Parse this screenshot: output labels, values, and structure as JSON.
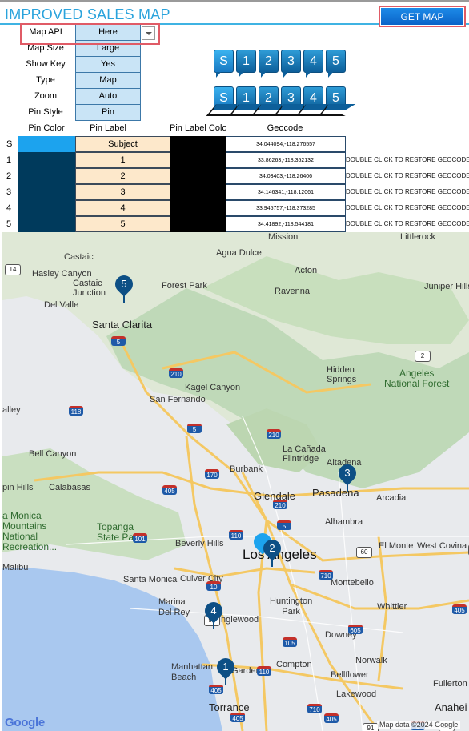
{
  "title": "IMPROVED SALES MAP",
  "get_map_label": "GET MAP",
  "settings": [
    {
      "label": "Map API",
      "value": "Here"
    },
    {
      "label": "Map Size",
      "value": "Large"
    },
    {
      "label": "Show Key",
      "value": "Yes"
    },
    {
      "label": "Type",
      "value": "Map"
    },
    {
      "label": "Zoom",
      "value": "Auto"
    },
    {
      "label": "Pin Style",
      "value": "Pin"
    }
  ],
  "pin_preview_labels": [
    "S",
    "1",
    "2",
    "3",
    "4",
    "5"
  ],
  "table": {
    "headers": [
      "Pin Color",
      "Pin Label",
      "Pin Label Colo",
      "Geocode"
    ],
    "rows": [
      {
        "id": "S",
        "label": "Subject",
        "geocode": "34.044094,-118.276557",
        "note": ""
      },
      {
        "id": "1",
        "label": "1",
        "geocode": "33.86263,-118.352132",
        "note": "DOUBLE CLICK TO RESTORE GEOCODE"
      },
      {
        "id": "2",
        "label": "2",
        "geocode": "34.03403,-118.26406",
        "note": "DOUBLE CLICK TO RESTORE GEOCODE"
      },
      {
        "id": "3",
        "label": "3",
        "geocode": "34.146341,-118.12061",
        "note": "DOUBLE CLICK TO RESTORE GEOCODE"
      },
      {
        "id": "4",
        "label": "4",
        "geocode": "33.945757,-118.373285",
        "note": "DOUBLE CLICK TO RESTORE GEOCODE"
      },
      {
        "id": "5",
        "label": "5",
        "geocode": "34.41892,-118.544181",
        "note": "DOUBLE CLICK TO RESTORE GEOCODE"
      }
    ]
  },
  "map": {
    "places": {
      "mission": "Mission",
      "littlerock": "Littlerock",
      "castaic": "Castaic",
      "agua_dulce": "Agua Dulce",
      "hasley": "Hasley Canyon",
      "acton": "Acton",
      "castaic_junction": "Castaic\nJunction",
      "forest_park": "Forest Park",
      "juniper": "Juniper Hills",
      "del_valle": "Del Valle",
      "ravenna": "Ravenna",
      "santa_clarita": "Santa Clarita",
      "kagel": "Kagel Canyon",
      "hidden_springs": "Hidden\nSprings",
      "angeles": "Angeles\nNational Forest",
      "san_fernando": "San Fernando",
      "alley": "alley",
      "canada": "La Cañada\nFlintridge",
      "bell_canyon": "Bell Canyon",
      "altadena": "Altadena",
      "burbank": "Burbank",
      "pasadena": "Pasadena",
      "calabasas": "Calabasas",
      "pin_hills": "pin Hills",
      "glendale": "Glendale",
      "arcadia": "Arcadia",
      "santa_monica_mtns": "a Monica\nMountains\nNational\nRecreation...",
      "topanga": "Topanga\nState Park",
      "alhambra": "Alhambra",
      "beverly_hills": "Beverly Hills",
      "los_angeles": "Los Angeles",
      "el_monte": "El Monte",
      "west_covina": "West Covina",
      "malibu": "Malibu",
      "santa_monica": "Santa Monica",
      "culver_city": "Culver City",
      "montebello": "Montebello",
      "huntington_park": "Huntington\nPark",
      "marina": "Marina\nDel Rey",
      "inglewood": "Inglewood",
      "whittier": "Whittier",
      "downey": "Downey",
      "compton": "Compton",
      "norwalk": "Norwalk",
      "manhattan_beach": "Manhattan\nBeach",
      "gardena": "Gardena",
      "bellflower": "Bellflower",
      "lakewood": "Lakewood",
      "fullerton": "Fullerton",
      "torrance": "Torrance",
      "anaheim": "Anahei"
    },
    "shields": [
      "14",
      "2",
      "5",
      "210",
      "118",
      "5",
      "210",
      "170",
      "405",
      "101",
      "2",
      "210",
      "110",
      "5",
      "105",
      "405",
      "10",
      "60",
      "710",
      "605",
      "405",
      "90",
      "110",
      "405",
      "710",
      "91",
      "405",
      "5",
      "57"
    ],
    "pins": [
      "5",
      "3",
      "2",
      "4",
      "1"
    ],
    "branding": "Google",
    "attribution": "Map data ©2024 Google"
  },
  "colors": {
    "accent": "#2aa3dc",
    "button": "#0a63c8",
    "highlight_border": "#e05b66",
    "pin": "#0d4f85",
    "subject_pin": "#1ca3ee"
  }
}
